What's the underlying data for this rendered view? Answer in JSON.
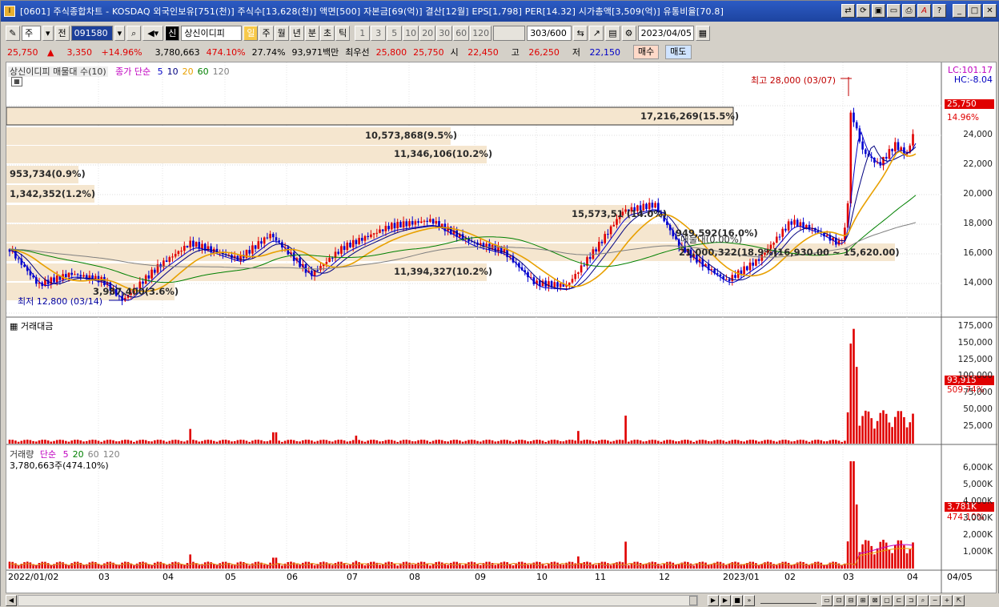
{
  "window": {
    "title": "[0601] 주식종합차트 - KOSDAQ 외국인보유[751(천)] 주식수[13,628(천)] 액면[500] 자본금[69(억)] 결산[12월] EPS[1,798] PER[14.32] 시가총액[3,509(억)] 유통비율[70.8]"
  },
  "toolbar": {
    "period_select": "주",
    "prev_label": "전",
    "code": "091580",
    "stock_name": "상신이디피",
    "market_badge": "신",
    "timeframes": [
      "일",
      "주",
      "월",
      "년",
      "분",
      "초",
      "틱"
    ],
    "active_timeframe": "일",
    "intervals": [
      "1",
      "3",
      "5",
      "10",
      "20",
      "30",
      "60",
      "120"
    ],
    "count": "303",
    "count_max": "/600",
    "date": "2023/04/05"
  },
  "quote": {
    "price": "25,750",
    "change_arrow": "▲",
    "change": "3,350",
    "change_pct": "+14.96%",
    "volume": "3,780,663",
    "volume_ratio": "474.10%",
    "turnover": "27.74%",
    "amount": "93,971백만",
    "best_bid_label": "최우선",
    "best_ask": "25,800",
    "best_bid": "25,750",
    "open_label": "시",
    "open": "22,450",
    "high_label": "고",
    "high": "26,250",
    "low_label": "저",
    "low": "22,150",
    "buy_label": "매수",
    "sell_label": "매도"
  },
  "price_panel": {
    "title": "상신이디피 매물대 수(10)",
    "ma_label": "종가 단순",
    "ma_periods": [
      "5",
      "10",
      "20",
      "60",
      "120"
    ],
    "ma_colors": [
      "#0000c8",
      "#000080",
      "#e8a000",
      "#008000",
      "#808080"
    ],
    "lc": "LC:101.17",
    "hc": "HC:-8.04",
    "high_note": "최고 28,000 (03/07)",
    "low_note": "최저 12,800 (03/14)",
    "last_price": "25,750",
    "last_pct": "14.96%",
    "y_ticks": [
      "24,000",
      "22,000",
      "20,000",
      "18,000",
      "16,000",
      "14,000"
    ],
    "profile_labels": [
      "17,216,269(15.5%)",
      "10,573,868(9.5%)",
      "11,346,106(10.2%)",
      "953,734(0.9%)",
      "1,342,352(1.2%)",
      "15,573,51 (14.0%)",
      "949,592(16.0%)",
      "매물대(0.00%)",
      "21,000,322(18.9%)",
      "(16,930.00 ~ 15,620.00)",
      "11,394,327(10.2%)",
      "3,987,400(3.6%)"
    ]
  },
  "amount_panel": {
    "title": "거래대금",
    "last_value": "93,915",
    "last_pct": "509.74%",
    "y_ticks": [
      "175,000",
      "150,000",
      "125,000",
      "100,000",
      "75,000",
      "50,000",
      "25,000"
    ]
  },
  "volume_panel": {
    "title": "거래량",
    "ma_label": "단순",
    "ma_periods": [
      "5",
      "20",
      "60",
      "120"
    ],
    "sub": "3,780,663주(474.10%)",
    "last_value": "3,781K",
    "last_pct": "474.10%",
    "y_ticks": [
      "6,000K",
      "5,000K",
      "4,000K",
      "3,000K",
      "2,000K",
      "1,000K"
    ]
  },
  "x_axis": {
    "labels": [
      "2022/01/02",
      "03",
      "04",
      "05",
      "06",
      "07",
      "08",
      "09",
      "10",
      "11",
      "12",
      "2023/01",
      "02",
      "03",
      "04",
      "04/05"
    ]
  },
  "chart_data": {
    "type": "candlestick",
    "ylim": [
      12000,
      28500
    ],
    "high": 28000,
    "low": 12800,
    "last": 25750
  }
}
